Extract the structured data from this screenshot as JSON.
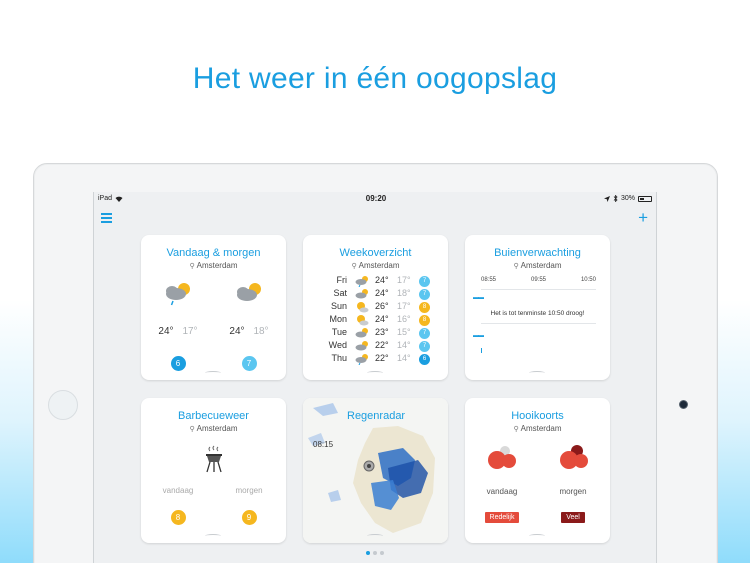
{
  "headline": "Het weer in één oogopslag",
  "status_bar": {
    "device": "iPad",
    "time": "09:20",
    "battery": "30%"
  },
  "location": "Amsterdam",
  "colors": {
    "accent": "#1a9ee0",
    "badge_blue": "#1a9ee0",
    "badge_light": "#5bc6f0",
    "badge_yellow": "#f5b71f",
    "pollen_low": "#e44b3b",
    "pollen_high": "#8b1a1a"
  },
  "cards": {
    "today": {
      "title": "Vandaag & morgen",
      "days": [
        {
          "icon": "cloud-rain-sun-icon",
          "high": "24°",
          "low": "17°",
          "badge": "6",
          "badge_color": "#1a9ee0"
        },
        {
          "icon": "cloud-sun-icon",
          "high": "24°",
          "low": "18°",
          "badge": "7",
          "badge_color": "#5bc6f0"
        }
      ]
    },
    "week": {
      "title": "Weekoverzicht",
      "rows": [
        {
          "day": "Fri",
          "icon": "cloud-rain-sun-icon",
          "high": "24°",
          "low": "17°",
          "badge": "7",
          "badge_color": "#5bc6f0"
        },
        {
          "day": "Sat",
          "icon": "cloud-sun-icon",
          "high": "24°",
          "low": "18°",
          "badge": "7",
          "badge_color": "#5bc6f0"
        },
        {
          "day": "Sun",
          "icon": "sun-cloud-icon",
          "high": "26°",
          "low": "17°",
          "badge": "8",
          "badge_color": "#f5b71f"
        },
        {
          "day": "Mon",
          "icon": "sun-cloud-icon",
          "high": "24°",
          "low": "16°",
          "badge": "8",
          "badge_color": "#f5b71f"
        },
        {
          "day": "Tue",
          "icon": "cloud-sun-icon",
          "high": "23°",
          "low": "15°",
          "badge": "7",
          "badge_color": "#5bc6f0"
        },
        {
          "day": "Wed",
          "icon": "cloud-sun-icon",
          "high": "22°",
          "low": "14°",
          "badge": "7",
          "badge_color": "#5bc6f0"
        },
        {
          "day": "Thu",
          "icon": "cloud-rain-sun-icon",
          "high": "22°",
          "low": "14°",
          "badge": "6",
          "badge_color": "#1a9ee0"
        }
      ]
    },
    "rain": {
      "title": "Buienverwachting",
      "times": [
        "08:55",
        "09:55",
        "10:50"
      ],
      "message": "Het is tot tenminste 10:50 droog!"
    },
    "bbq": {
      "title": "Barbecueweer",
      "days": [
        {
          "label": "vandaag",
          "badge": "8"
        },
        {
          "label": "morgen",
          "badge": "9"
        }
      ]
    },
    "radar": {
      "title": "Regenradar",
      "time": "08:15"
    },
    "hay": {
      "title": "Hooikoorts",
      "days": [
        {
          "label": "vandaag",
          "level": "Redelijk",
          "color": "#e44b3b"
        },
        {
          "label": "morgen",
          "level": "Veel",
          "color": "#8b1a1a"
        }
      ]
    }
  },
  "pagination": {
    "pages": 3,
    "active": 0
  }
}
